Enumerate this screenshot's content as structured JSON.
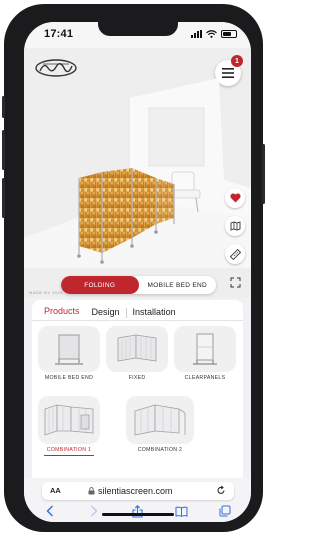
{
  "status_bar": {
    "time": "17:41"
  },
  "header": {
    "notification_count": "1"
  },
  "hero": {
    "made_by": "MADE BY 1020",
    "toggle": {
      "options": [
        "FOLDING",
        "MOBILE BED END"
      ],
      "selected": "FOLDING"
    },
    "tools": [
      "heart-icon",
      "map-icon",
      "ruler-icon",
      "fullscreen-icon"
    ]
  },
  "tabs": [
    {
      "label": "Products",
      "active": true
    },
    {
      "label": "Design",
      "active": false
    },
    {
      "label": "Installation",
      "active": false
    }
  ],
  "products": [
    {
      "label": "MOBILE BED END",
      "active": false
    },
    {
      "label": "FIXED",
      "active": false
    },
    {
      "label": "CLEARPANELS",
      "active": false
    },
    {
      "label": "COMBINATION 1",
      "active": true
    },
    {
      "label": "COMBINATION 2",
      "active": false
    }
  ],
  "browser": {
    "aa": "AA",
    "url": "silentiascreen.com"
  },
  "colors": {
    "accent": "#c0272d",
    "panel_print": "#d9a24a"
  }
}
